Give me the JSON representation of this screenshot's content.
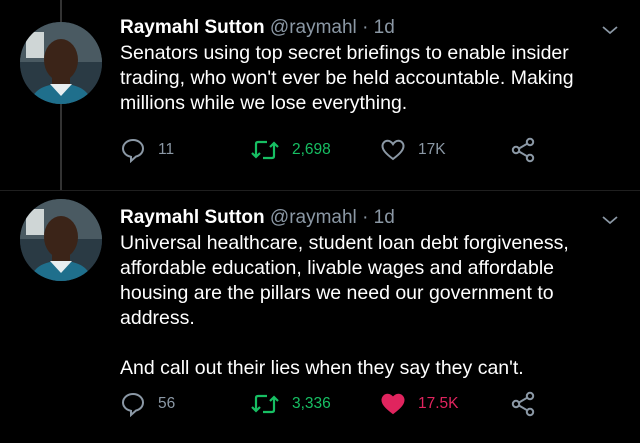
{
  "tweets": [
    {
      "author_name": "Raymahl Sutton",
      "handle": "@raymahl",
      "separator": "·",
      "time": "1d",
      "text": "Senators using top secret briefings to enable insider\ntrading, who won't ever be held accountable. Making\nmillions while we lose everything.",
      "replies": "11",
      "retweets": "2,698",
      "likes": "17K",
      "liked": false,
      "retweeted": true
    },
    {
      "author_name": "Raymahl Sutton",
      "handle": "@raymahl",
      "separator": "·",
      "time": "1d",
      "text": "Universal healthcare, student loan debt forgiveness,\naffordable education, livable wages and affordable\nhousing are the pillars we need our government to\naddress.\n\nAnd call out their lies when they say they can't.",
      "replies": "56",
      "retweets": "3,336",
      "likes": "17.5K",
      "liked": true,
      "retweeted": true
    }
  ],
  "icons": {
    "reply": "reply-icon",
    "retweet": "retweet-icon",
    "like": "heart-icon",
    "share": "share-icon",
    "more": "chevron-down-icon"
  },
  "colors": {
    "background": "#000000",
    "secondary_text": "#8b98a5",
    "retweet_green": "#17bf63",
    "like_red": "#e0245e"
  }
}
